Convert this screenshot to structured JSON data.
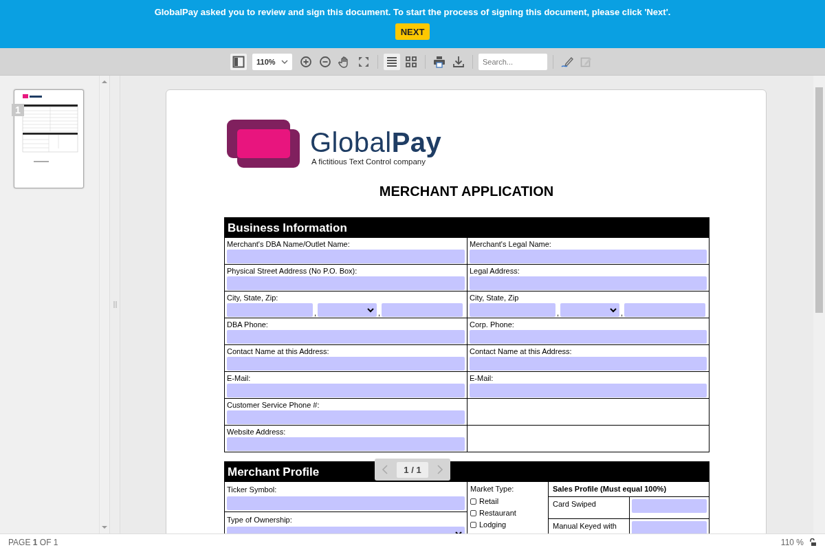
{
  "banner": {
    "message": "GlobalPay asked you to review and sign this document. To start the process of signing this document, please click 'Next'.",
    "button": "NEXT"
  },
  "toolbar": {
    "tools": [
      {
        "kind": "sidebar",
        "selected": true,
        "disabled": false
      },
      {
        "kind": "zoom",
        "value": "110%"
      },
      {
        "kind": "zoomin",
        "selected": false,
        "disabled": false
      },
      {
        "kind": "zoomout",
        "selected": false,
        "disabled": false
      },
      {
        "kind": "hand",
        "selected": false,
        "disabled": false
      },
      {
        "kind": "fit",
        "selected": false,
        "disabled": false
      },
      {
        "kind": "sep"
      },
      {
        "kind": "single",
        "selected": true,
        "disabled": false
      },
      {
        "kind": "grid",
        "selected": false,
        "disabled": false
      },
      {
        "kind": "sep"
      },
      {
        "kind": "print",
        "selected": false,
        "disabled": false
      },
      {
        "kind": "download",
        "selected": false,
        "disabled": false
      },
      {
        "kind": "sep"
      },
      {
        "kind": "search",
        "placeholder": "Search..."
      },
      {
        "kind": "sep"
      },
      {
        "kind": "sign",
        "selected": false,
        "disabled": false
      },
      {
        "kind": "edit",
        "selected": false,
        "disabled": true
      }
    ]
  },
  "thumbnails": [
    {
      "number": "1",
      "selected": true
    }
  ],
  "document": {
    "logo": {
      "name": "Global",
      "name_bold": "Pay",
      "tagline": "A fictitious Text Control company"
    },
    "title": "MERCHANT APPLICATION",
    "business": {
      "heading": "Business Information",
      "rows": [
        {
          "cells": [
            {
              "kind": "text",
              "label": "Merchant's DBA Name/Outlet Name:"
            },
            {
              "kind": "text",
              "label": "Merchant's Legal Name:"
            }
          ]
        },
        {
          "cells": [
            {
              "kind": "text",
              "label": "Physical Street Address (No P.O. Box):"
            },
            {
              "kind": "text",
              "label": "Legal Address:"
            }
          ]
        },
        {
          "cells": [
            {
              "kind": "address",
              "label": "City, State, Zip:",
              "separators": [
                ",",
                ","
              ]
            },
            {
              "kind": "address",
              "label": "City, State, Zip",
              "separators": [
                ",",
                ","
              ]
            }
          ]
        },
        {
          "cells": [
            {
              "kind": "text",
              "label": "DBA Phone:"
            },
            {
              "kind": "text",
              "label": "Corp. Phone:"
            }
          ]
        },
        {
          "cells": [
            {
              "kind": "text",
              "label": "Contact Name at this Address:"
            },
            {
              "kind": "text",
              "label": "Contact Name at this Address:"
            }
          ]
        },
        {
          "cells": [
            {
              "kind": "text",
              "label": "E-Mail:"
            },
            {
              "kind": "text",
              "label": "E-Mail:"
            }
          ]
        },
        {
          "cells": [
            {
              "kind": "text",
              "label": "Customer Service Phone #:"
            },
            {
              "kind": "blank"
            }
          ]
        },
        {
          "cells": [
            {
              "kind": "text",
              "label": "Website Address:"
            },
            {
              "kind": "blank"
            }
          ]
        }
      ]
    },
    "profile": {
      "heading": "Merchant Profile",
      "left": [
        {
          "kind": "text",
          "label": "Ticker Symbol:"
        },
        {
          "kind": "select",
          "label": "Type of Ownership:"
        }
      ],
      "market": {
        "label": "Market Type:",
        "options": [
          {
            "label": "Retail",
            "checked": false
          },
          {
            "label": "Restaurant",
            "checked": false
          },
          {
            "label": "Lodging",
            "checked": false
          }
        ]
      },
      "sales": {
        "heading": "Sales Profile (Must equal 100%)",
        "rows": [
          {
            "label": "Card Swiped"
          },
          {
            "label": "Manual Keyed with"
          }
        ]
      }
    }
  },
  "pager": {
    "text": "1 / 1"
  },
  "status_bar": {
    "page": "PAGE **1** OF 1",
    "zoom": "110 %"
  }
}
